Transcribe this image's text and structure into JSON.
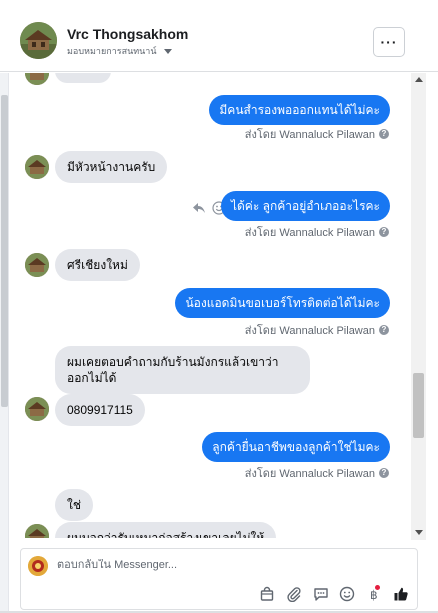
{
  "header": {
    "name": "Vrc Thongsakhom",
    "subtitle": "มอบหมายการสนทนาน์",
    "more_label": "···"
  },
  "messages": [
    {
      "dir": "out",
      "text": "มีคนสำรองพอออกแทนได้ไม่คะ",
      "sent_by": "ส่งโดย Wannaluck Pilawan"
    },
    {
      "dir": "in",
      "text": "มีหัวหน้างานครับ"
    },
    {
      "dir": "out",
      "text": "ได้ค่ะ ลูกค้าอยู่อำเภออะไรคะ",
      "sent_by": "ส่งโดย Wannaluck Pilawan"
    },
    {
      "dir": "in",
      "text": "ศรีเชียงใหม่"
    },
    {
      "dir": "out",
      "text": "น้องแอดมินขอเบอร์โทรติดต่อได้ไม่คะ",
      "sent_by": "ส่งโดย Wannaluck Pilawan"
    },
    {
      "dir": "in",
      "text": "ผมเคยตอบคำถามกับร้านมังกรแล้วเขาว่าออกไม่ได้"
    },
    {
      "dir": "in",
      "text": "0809917115"
    },
    {
      "dir": "out",
      "text": "ลูกค้ายื่นอาชีพของลูกค้าใช่ไมคะ",
      "sent_by": "ส่งโดย Wannaluck Pilawan"
    },
    {
      "dir": "in",
      "text": "ใช่"
    },
    {
      "dir": "in",
      "text": "ผมบอกว่ารับเหมาก่อสร้างเขาเลยไม่ให้"
    }
  ],
  "composer": {
    "placeholder": "ตอบกลับใน Messenger..."
  },
  "icons": {
    "more": "more-dots-icon",
    "reply": "reply-icon",
    "react": "smiley-icon",
    "help": "question-icon",
    "tools": [
      "shop-bag-icon",
      "paperclip-icon",
      "saved-replies-icon",
      "emoji-icon",
      "payment-icon",
      "thumbs-up-icon"
    ]
  },
  "colors": {
    "outgoing_bubble": "#1877f2",
    "incoming_bubble": "#e4e6eb",
    "notification_dot": "#e41e3f"
  }
}
